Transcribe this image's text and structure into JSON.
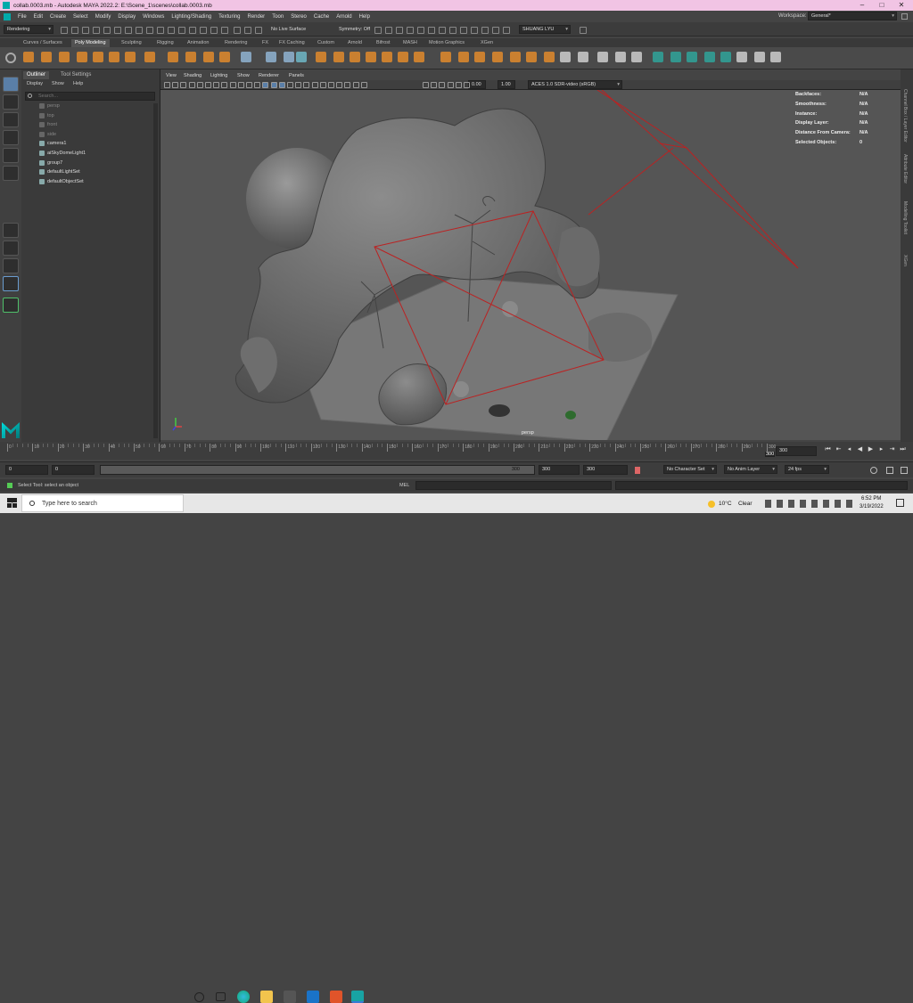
{
  "title": "collab.0003.mb - Autodesk MAYA 2022.2: E:\\Scene_1\\scenes\\collab.0003.mb",
  "window_controls": {
    "minimize": "–",
    "maximize": "□",
    "close": "✕"
  },
  "menus": [
    "File",
    "Edit",
    "Create",
    "Select",
    "Modify",
    "Display",
    "Windows",
    "Lighting/Shading",
    "Texturing",
    "Render",
    "Toon",
    "Stereo",
    "Cache",
    "Arnold",
    "Help"
  ],
  "workspace": {
    "label": "Workspace:",
    "value": "General*"
  },
  "status_line": {
    "menu_set": "Rendering",
    "live_surface": "No Live Surface",
    "symmetry": "Symmetry: Off",
    "user": "SHUANG LYU"
  },
  "shelf_tabs": [
    "Curves / Surfaces",
    "Poly Modeling",
    "Sculpting",
    "Rigging",
    "Animation",
    "Rendering",
    "FX",
    "FX Caching",
    "Custom",
    "Arnold",
    "Bifrost",
    "MASH",
    "Motion Graphics",
    "XGen"
  ],
  "shelf_active": "Poly Modeling",
  "outliner": {
    "tabs": [
      "Outliner",
      "Tool Settings"
    ],
    "menu": [
      "Display",
      "Show",
      "Help"
    ],
    "search_placeholder": "Search...",
    "items": [
      {
        "label": "persp",
        "dim": true
      },
      {
        "label": "top",
        "dim": true
      },
      {
        "label": "front",
        "dim": true
      },
      {
        "label": "side",
        "dim": true
      },
      {
        "label": "camera1",
        "dim": false
      },
      {
        "label": "aiSkyDomeLight1",
        "dim": false
      },
      {
        "label": "group7",
        "dim": false
      },
      {
        "label": "defaultLightSet",
        "dim": false
      },
      {
        "label": "defaultObjectSet",
        "dim": false
      }
    ]
  },
  "viewport": {
    "menu": [
      "View",
      "Shading",
      "Lighting",
      "Show",
      "Renderer",
      "Panels"
    ],
    "exposure": "0.00",
    "gamma": "1.00",
    "color_space": "ACES 1.0 SDR-video (sRGB)",
    "camera_label": "persp",
    "hud": [
      {
        "label": "Backfaces:",
        "value": "N/A"
      },
      {
        "label": "Smoothness:",
        "value": "N/A"
      },
      {
        "label": "Instance:",
        "value": "N/A"
      },
      {
        "label": "Display Layer:",
        "value": "N/A"
      },
      {
        "label": "Distance From Camera:",
        "value": "N/A"
      },
      {
        "label": "Selected Objects:",
        "value": "0"
      }
    ]
  },
  "right_tabs": [
    "Channel Box / Layer Editor",
    "Attribute Editor",
    "Modelling Toolkit",
    "XGen"
  ],
  "timeline": {
    "ticks": [
      "0",
      "10",
      "20",
      "30",
      "40",
      "50",
      "60",
      "70",
      "80",
      "90",
      "100",
      "110",
      "120",
      "130",
      "140",
      "150",
      "160",
      "170",
      "180",
      "190",
      "200",
      "210",
      "220",
      "230",
      "240",
      "250",
      "260",
      "270",
      "280",
      "290",
      "300"
    ],
    "current_frame": "300",
    "current_marker": "300"
  },
  "range": {
    "start": "0",
    "anim_start": "0",
    "range_end_label": "300",
    "end": "300",
    "anim_end": "300",
    "character_set": "No Character Set",
    "anim_layer": "No Anim Layer",
    "fps": "24 fps"
  },
  "command": {
    "help_text": "Select Tool: select an object",
    "mel_label": "MEL"
  },
  "taskbar": {
    "search": "Type here to search",
    "weather_temp": "10°C",
    "weather_desc": "Clear",
    "time": "6:52 PM",
    "date": "3/19/2022"
  }
}
